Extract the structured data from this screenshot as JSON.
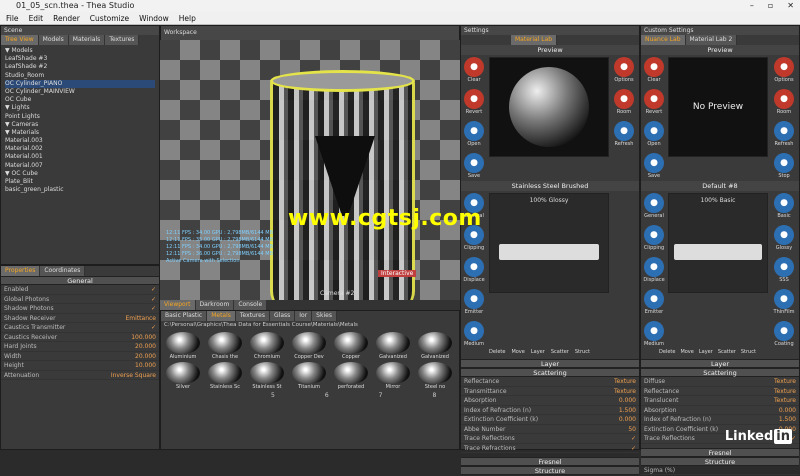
{
  "window": {
    "title": "01_05_scn.thea - Thea Studio",
    "controls": [
      "–",
      "▫",
      "✕"
    ]
  },
  "menu": [
    "File",
    "Edit",
    "Render",
    "Customize",
    "Window",
    "Help"
  ],
  "scene_panel": {
    "header": "Scene",
    "tabs": [
      "Tree View",
      "Models",
      "Materials",
      "Textures"
    ],
    "tree": [
      "▼ Models",
      "   LeafShade #3",
      "   LeafShade #2",
      "   Studio_Room",
      "   OC Cylinder_PIANO",
      "   OC Cylinder_MAINVIEW",
      "   OC Cube",
      "▼ Lights",
      "   Point Lights",
      "▼ Cameras",
      "▼ Materials",
      "   Material.003",
      "   Material.002",
      "   Material.001",
      "   Material.007",
      "▼ OC Cube",
      "   Plate_Blit",
      "   basic_green_plastic"
    ],
    "selected_index": 4
  },
  "properties_panel": {
    "tabs": [
      "Properties",
      "Coordinates"
    ],
    "section_general": "General",
    "rows": [
      {
        "label": "Enabled",
        "value": "✓"
      },
      {
        "label": "Global Photons",
        "value": "✓"
      },
      {
        "label": "Shadow Photons",
        "value": "✓"
      },
      {
        "label": "Shadow Receiver",
        "value": "Emittance"
      },
      {
        "label": "Caustics Transmitter",
        "value": "✓"
      },
      {
        "label": "Caustics Receiver",
        "value": "100.000"
      },
      {
        "label": "Hard Joints",
        "value": "20.000"
      },
      {
        "label": "Width",
        "value": "20.000"
      },
      {
        "label": "Height",
        "value": "10.000"
      },
      {
        "label": "Attenuation",
        "value": "Inverse Square"
      }
    ]
  },
  "viewport": {
    "header": "Workspace",
    "tabs": [
      "Viewport",
      "Darkroom",
      "Console"
    ],
    "console_lines": [
      "12:11 FPS : 34.00 GPU : 2,798MB/6144 MB",
      "12:11 FPS : 35.00 GPU : 2,798MB/6144 MB",
      "12:11 FPS : 34.00 GPU : 2,798MB/6144 MB",
      "12:11 FPS : 36.00 GPU : 2,798MB/6144 MB",
      "Active Camera with Selection"
    ],
    "camera_label": "Camera #2",
    "interactive_label": "Interactive"
  },
  "library": {
    "tabs": [
      "Basic Plastic",
      "Metals",
      "Textures",
      "Glass",
      "Ior",
      "Skies"
    ],
    "path": "C:\\Personal\\Graphics\\Thea Data for Essentials Course\\Materials\\Metals",
    "materials": [
      "Aluminium",
      "Chasis the",
      "Chromium",
      "Copper Dev",
      "Copper",
      "Galvanized",
      "Galvanized",
      "Gold",
      "Silver",
      "Stainless Sc",
      "Stainless St",
      "Titanium",
      "perforated",
      "Mirror",
      "Steel no",
      "Brass"
    ],
    "page_numbers": [
      "5",
      "6",
      "7",
      "8"
    ]
  },
  "material_lab_1": {
    "header": "Settings",
    "tab": "Material Lab",
    "preview_title": "Preview",
    "material_name": "Stainless Steel Brushed",
    "glossy_label": "100% Glossy",
    "side_buttons": [
      "Clear",
      "Revert",
      "Open",
      "Save",
      "General",
      "Clipping",
      "Displace",
      "Emitter",
      "Medium"
    ],
    "right_buttons": [
      "Options",
      "Room",
      "Refresh"
    ],
    "bottom_buttons": [
      "Delete",
      "Move",
      "Layer",
      "Scatter",
      "Struct"
    ],
    "layer_section": "Layer",
    "scattering_section": "Scattering",
    "rows": [
      {
        "label": "Reflectance",
        "value": "Texture"
      },
      {
        "label": "Transmittance",
        "value": "Texture"
      },
      {
        "label": "Absorption",
        "value": "0.000"
      },
      {
        "label": "Index of Refraction (n)",
        "value": "1.500"
      },
      {
        "label": "Extinction Coefficient (k)",
        "value": "0.000"
      },
      {
        "label": "Abbe Number",
        "value": "50"
      },
      {
        "label": "Trace Reflections",
        "value": "✓"
      },
      {
        "label": "Trace Refractions",
        "value": "✓"
      }
    ],
    "fresnel_section": "Fresnel",
    "structure_section": "Structure"
  },
  "material_lab_2": {
    "header": "Custom Settings",
    "tabs": [
      "Nuance Lab",
      "Material Lab 2"
    ],
    "preview_title": "Preview",
    "no_preview": "No Preview",
    "material_name": "Default #8",
    "basic_label": "100% Basic",
    "side_buttons": [
      "Clear",
      "Revert",
      "Open",
      "Save",
      "General",
      "Clipping",
      "Displace",
      "Emitter",
      "Medium"
    ],
    "right_buttons": [
      "Options",
      "Room",
      "Refresh",
      "Stop",
      "Basic",
      "Glossy",
      "SSS",
      "ThinFilm",
      "Coating"
    ],
    "bottom_buttons": [
      "Delete",
      "Move",
      "Layer",
      "Scatter",
      "Struct"
    ],
    "layer_section": "Layer",
    "scattering_section": "Scattering",
    "rows": [
      {
        "label": "Diffuse",
        "value": "Texture"
      },
      {
        "label": "Reflectance",
        "value": "Texture"
      },
      {
        "label": "Translucent",
        "value": "Texture"
      },
      {
        "label": "Absorption",
        "value": "0.000"
      },
      {
        "label": "Index of Refraction (n)",
        "value": "1.500"
      },
      {
        "label": "Extinction Coefficient (k)",
        "value": "0.000"
      },
      {
        "label": "Trace Reflections",
        "value": "✓"
      }
    ],
    "fresnel_section": "Fresnel",
    "structure_section": "Structure",
    "sigma_label": "Sigma (%)"
  },
  "watermark": "www.cgtsj.com",
  "brand": {
    "text": "Linked",
    "badge": "in"
  },
  "colors": {
    "accent": "#f5a623",
    "selection": "#2c4a78",
    "watermark": "#ffff00",
    "highlight": "#e4e44a"
  }
}
